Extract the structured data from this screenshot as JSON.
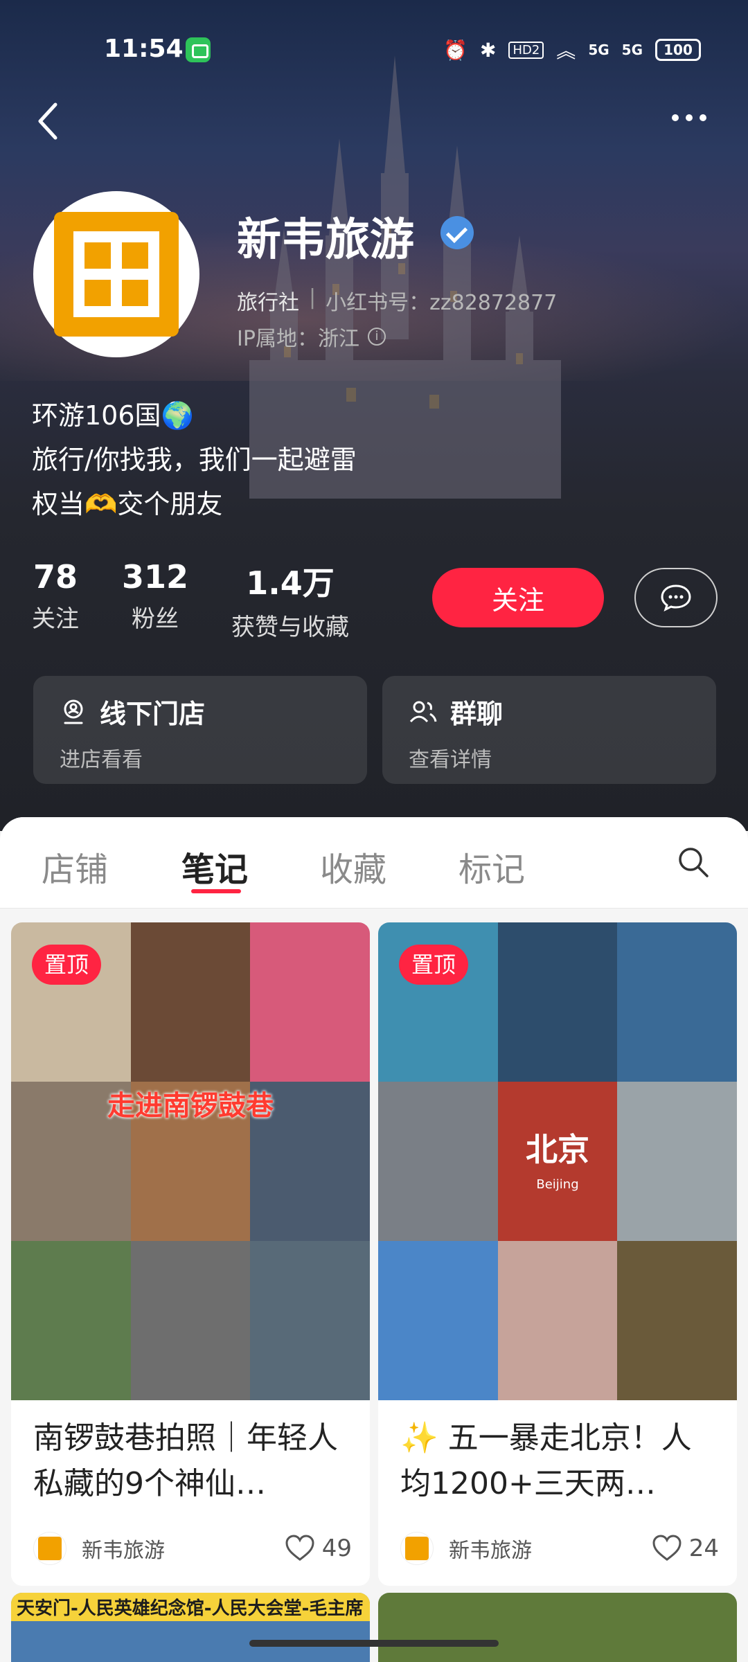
{
  "status_bar": {
    "time": "11:54",
    "battery": "100",
    "signal_labels": [
      "5G",
      "5G"
    ],
    "hd_label": "HD2"
  },
  "profile": {
    "name": "新韦旅游",
    "category": "旅行社",
    "xhs_id_label": "小红书号：zz82872877",
    "ip_location": "IP属地：浙江",
    "bio": [
      "环游106国🌍",
      "旅行/你找我，我们一起避雷",
      "权当🫶交个朋友"
    ]
  },
  "stats": [
    {
      "value": "78",
      "label": "关注"
    },
    {
      "value": "312",
      "label": "粉丝"
    },
    {
      "value": "1.4万",
      "label": "获赞与收藏"
    }
  ],
  "actions": {
    "follow": "关注"
  },
  "cards": [
    {
      "title": "线下门店",
      "subtitle": "进店看看",
      "icon": "location-person-icon"
    },
    {
      "title": "群聊",
      "subtitle": "查看详情",
      "icon": "group-icon"
    }
  ],
  "tabs": [
    {
      "label": "店铺"
    },
    {
      "label": "笔记"
    },
    {
      "label": "收藏"
    },
    {
      "label": "标记"
    }
  ],
  "active_tab": "笔记",
  "notes": [
    {
      "pin_label": "置顶",
      "image_caption": "走进南锣鼓巷",
      "title": "南锣鼓巷拍照｜年轻人私藏的9个神仙…",
      "author": "新韦旅游",
      "likes": "49"
    },
    {
      "pin_label": "置顶",
      "image_badge": "北京",
      "image_badge_sub": "Beijing",
      "title": "✨ 五一暴走北京！人均1200+三天两…",
      "author": "新韦旅游",
      "likes": "24"
    }
  ],
  "next_row_caption": "天安门-人民英雄纪念馆-人民大会堂-毛主席",
  "colors": {
    "accent": "#ff2442",
    "avatar_brand": "#f2a100",
    "verified": "#4a90e2"
  }
}
